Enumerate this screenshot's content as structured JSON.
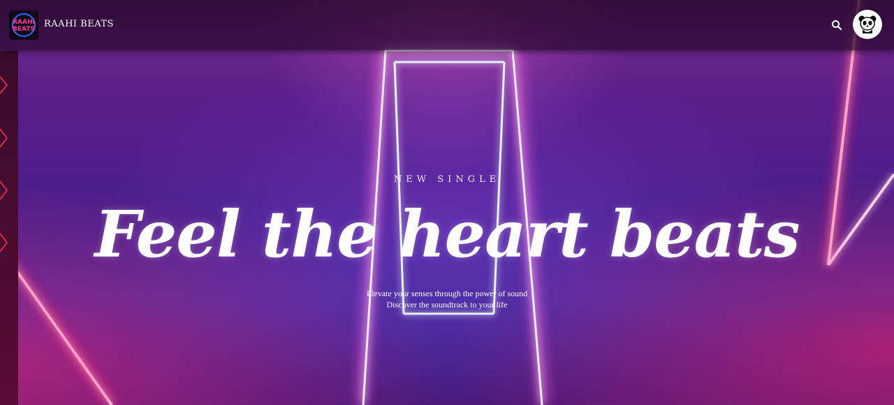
{
  "header": {
    "brand": "RAAHI BEATS",
    "logo_text_top": "RAAHI",
    "logo_text_bottom": "BEATS",
    "search_icon": "search-icon",
    "avatar_icon": "panda-icon"
  },
  "hero": {
    "kicker": "NEW SINGLE",
    "headline": "Feel the heart beats",
    "subtitle_line1": "Elevate your senses through the power of sound",
    "subtitle_line2": "Discover the soundtrack to your life"
  },
  "colors": {
    "neon_pink": "#ff2f7a",
    "neon_blue": "#8fb4ff",
    "purple": "#5a1e8a"
  }
}
